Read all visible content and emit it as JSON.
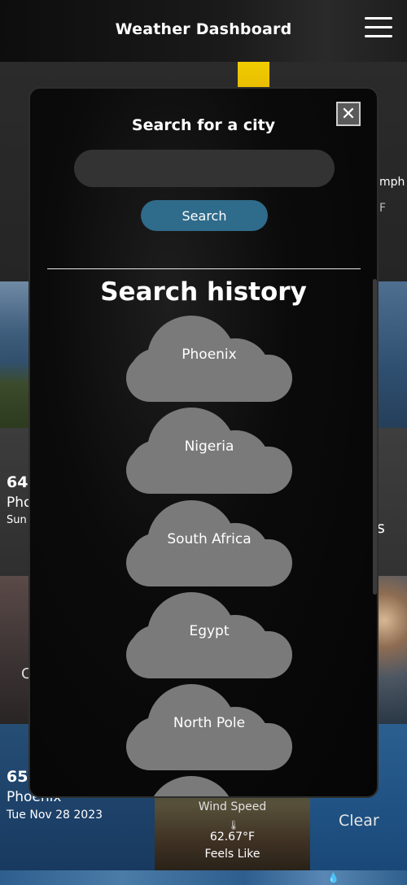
{
  "header": {
    "title": "Weather Dashboard",
    "menu_icon": "hamburger-icon"
  },
  "background": {
    "wind_unit_fragment": "mph",
    "temp_unit_fragment": "F",
    "card_left_temp": "64",
    "card_left_city": "Pho",
    "card_left_date": "Sun",
    "card_right_fragment": "s",
    "card_mid_left_fragment": "C",
    "card_bottom": {
      "temp": "65",
      "city": "Phoenix",
      "date": "Tue Nov 28 2023"
    },
    "wind_label": "Wind Speed",
    "thermometer_icon": "thermometer-icon",
    "feels_like_value": "62.67°F",
    "feels_like_label": "Feels Like",
    "condition": "Clear",
    "droplet_icon": "droplet-icon"
  },
  "modal": {
    "close_icon": "close-icon",
    "close_label": "✕",
    "search_label": "Search for a city",
    "search_value": "",
    "search_placeholder": "",
    "search_button_label": "Search",
    "history_title": "Search history",
    "history": [
      {
        "label": "Phoenix"
      },
      {
        "label": "Nigeria"
      },
      {
        "label": "South Africa"
      },
      {
        "label": "Egypt"
      },
      {
        "label": "North Pole"
      },
      {
        "label": ""
      }
    ]
  },
  "colors": {
    "modal_bg": "#050505",
    "cloud_fill": "#7a7a7a",
    "search_button": "#2f6b8a",
    "input_bg": "#333333",
    "accent_yellow": "#f0cc00"
  }
}
